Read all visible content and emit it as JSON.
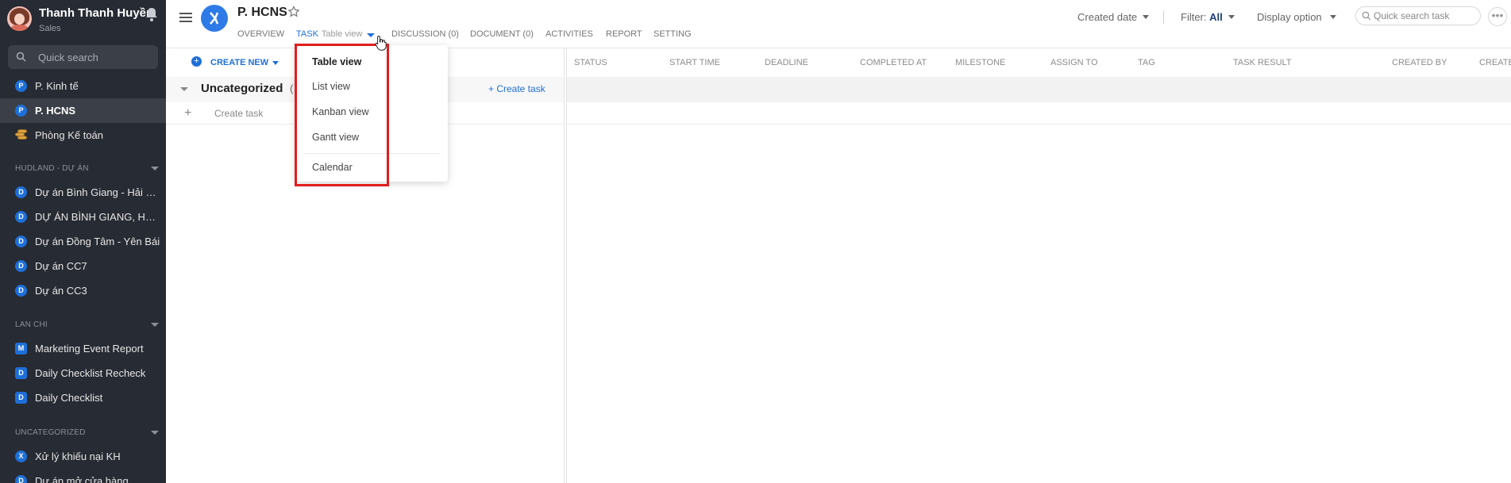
{
  "sidebar": {
    "user": {
      "name": "Thanh Thanh Huyền",
      "role": "Sales"
    },
    "search_placeholder": "Quick search",
    "top_items": [
      {
        "badge": "P",
        "label": "P. Kinh tế"
      },
      {
        "badge": "P",
        "label": "P. HCNS"
      },
      {
        "badge": "",
        "label": "Phòng Kế toán"
      }
    ],
    "sections": [
      {
        "title": "HUDLAND - DỰ ÁN",
        "items": [
          {
            "badge": "D",
            "label": "Dự án Bình Giang - Hải Dương"
          },
          {
            "badge": "D",
            "label": "DỰ ÁN BÌNH GIANG, HẢI DƯƠNG"
          },
          {
            "badge": "D",
            "label": "Dự án Đồng Tâm - Yên Bái"
          },
          {
            "badge": "D",
            "label": "Dự án CC7"
          },
          {
            "badge": "D",
            "label": "Dự án CC3"
          }
        ]
      },
      {
        "title": "LAN CHI",
        "items": [
          {
            "badge": "M",
            "label": "Marketing Event Report"
          },
          {
            "badge": "D",
            "label": "Daily Checklist Recheck"
          },
          {
            "badge": "D",
            "label": "Daily Checklist"
          }
        ]
      },
      {
        "title": "UNCATEGORIZED",
        "items": [
          {
            "badge": "X",
            "label": "Xử lý khiếu nại KH"
          },
          {
            "badge": "D",
            "label": "Dự án mở cửa hàng"
          }
        ]
      }
    ]
  },
  "header": {
    "project_title": "P. HCNS",
    "tabs": {
      "overview": "OVERVIEW",
      "task": "TASK",
      "task_view": "Table view",
      "discussion": "DISCUSSION (0)",
      "document": "DOCUMENT (0)",
      "activities": "ACTIVITIES",
      "report": "REPORT",
      "setting": "SETTING"
    },
    "sort": "Created date",
    "filter_label": "Filter:",
    "filter_value": "All",
    "display_option": "Display option",
    "search_placeholder": "Quick search task"
  },
  "toolbar": {
    "create_new": "CREATE NEW"
  },
  "columns": [
    "STATUS",
    "START TIME",
    "DEADLINE",
    "COMPLETED AT",
    "MILESTONE",
    "ASSIGN TO",
    "TAG",
    "TASK RESULT",
    "CREATED BY",
    "CREATED"
  ],
  "group": {
    "title": "Uncategorized",
    "count": "(",
    "create_link": "+ Create task",
    "create_row": "Create task"
  },
  "view_menu": {
    "items": [
      "Table view",
      "List view",
      "Kanban view",
      "Gantt view"
    ],
    "calendar": "Calendar",
    "selected": "Table view"
  },
  "colors": {
    "accent": "#1e6fd9",
    "sidebar_bg": "#272b33",
    "highlight": "#e11d1d"
  }
}
